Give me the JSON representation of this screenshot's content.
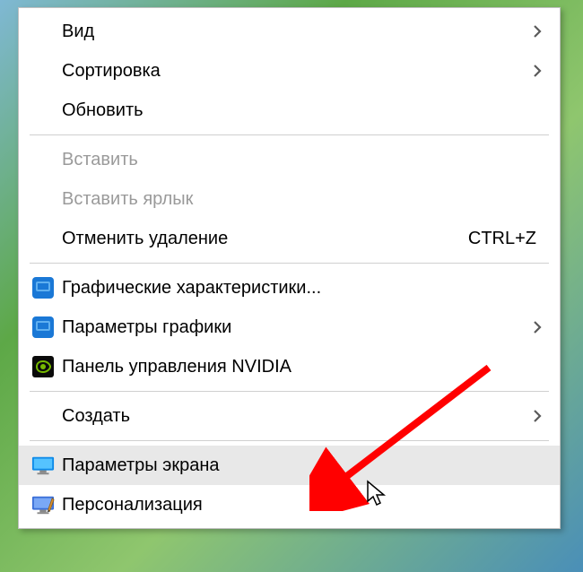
{
  "menu": {
    "groups": [
      {
        "items": [
          {
            "id": "view",
            "label": "Вид",
            "submenu": true,
            "icon": null,
            "disabled": false
          },
          {
            "id": "sort",
            "label": "Сортировка",
            "submenu": true,
            "icon": null,
            "disabled": false
          },
          {
            "id": "refresh",
            "label": "Обновить",
            "submenu": false,
            "icon": null,
            "disabled": false
          }
        ]
      },
      {
        "items": [
          {
            "id": "paste",
            "label": "Вставить",
            "submenu": false,
            "icon": null,
            "disabled": true
          },
          {
            "id": "paste-shortcut",
            "label": "Вставить ярлык",
            "submenu": false,
            "icon": null,
            "disabled": true
          },
          {
            "id": "undo-delete",
            "label": "Отменить удаление",
            "submenu": false,
            "icon": null,
            "disabled": false,
            "shortcut": "CTRL+Z"
          }
        ]
      },
      {
        "items": [
          {
            "id": "intel-gfx-props",
            "label": "Графические характеристики...",
            "submenu": false,
            "icon": "intel-blue",
            "disabled": false
          },
          {
            "id": "intel-gfx-params",
            "label": "Параметры графики",
            "submenu": true,
            "icon": "intel-blue",
            "disabled": false
          },
          {
            "id": "nvidia-panel",
            "label": "Панель управления NVIDIA",
            "submenu": false,
            "icon": "nvidia",
            "disabled": false
          }
        ]
      },
      {
        "items": [
          {
            "id": "new",
            "label": "Создать",
            "submenu": true,
            "icon": null,
            "disabled": false
          }
        ]
      },
      {
        "items": [
          {
            "id": "display-settings",
            "label": "Параметры экрана",
            "submenu": false,
            "icon": "monitor",
            "disabled": false,
            "highlighted": true
          },
          {
            "id": "personalize",
            "label": "Персонализация",
            "submenu": false,
            "icon": "personalize",
            "disabled": false
          }
        ]
      }
    ]
  },
  "colors": {
    "intel": "#1a78d6",
    "nvidia_bg": "#0a0a0a",
    "nvidia_eye": "#76b900",
    "monitor": "#0d8ae8",
    "personalize_bg": "#3a6fd8",
    "arrow": "#ff0000"
  }
}
